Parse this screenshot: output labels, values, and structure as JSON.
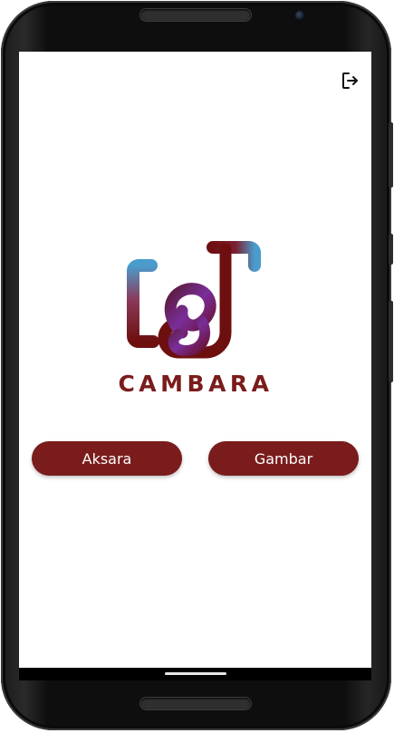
{
  "app": {
    "brand_name": "CAMBARA",
    "logo_icon": "cambara-logo-icon",
    "logout_icon": "logout-icon"
  },
  "actions": {
    "aksara_label": "Aksara",
    "gambar_label": "Gambar"
  },
  "colors": {
    "primary": "#7a1c1c",
    "button_text": "#ffffff",
    "background": "#ffffff",
    "logo_blue": "#4a9ccc",
    "logo_purple": "#7a2e9a"
  }
}
